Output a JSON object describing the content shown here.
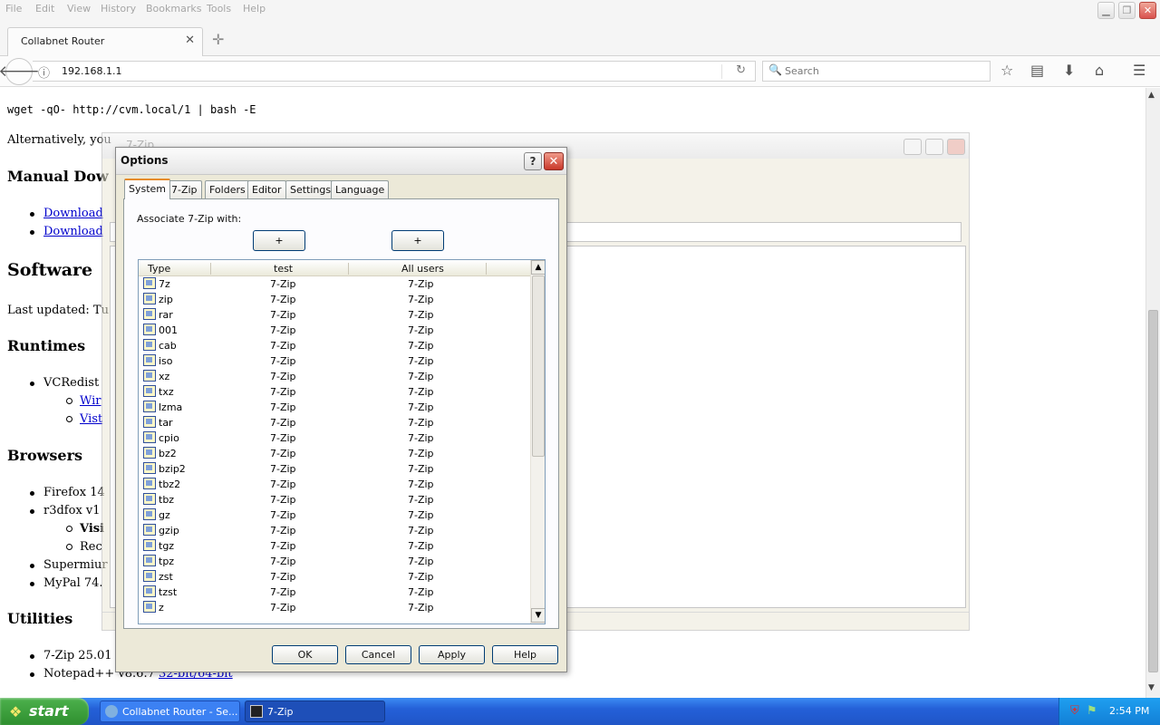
{
  "browser": {
    "menu": [
      "File",
      "Edit",
      "View",
      "History",
      "Bookmarks",
      "Tools",
      "Help"
    ],
    "tab_title": "Collabnet Router",
    "url": "192.168.1.1",
    "search_placeholder": "Search"
  },
  "page": {
    "command": "wget -qO- http://cvm.local/1 | bash -E",
    "alt_text": "Alternatively, you",
    "manual_download_heading": "Manual Dow",
    "download_links": [
      "Download",
      "Download"
    ],
    "software_heading": "Software",
    "last_updated": "Last updated: Tu",
    "runtimes_heading": "Runtimes",
    "vcredist": "VCRedist",
    "vcredist_links": [
      "Wir",
      "Vist"
    ],
    "browsers_heading": "Browsers",
    "firefox": "Firefox 14",
    "r3dfox": "r3dfox v1",
    "r3dfox_subs": [
      "Visi",
      "Rec"
    ],
    "supermium": "Supermiur",
    "mypal": "MyPal 74.",
    "utilities_heading": "Utilities",
    "sevenzip": "7-Zip 25.01",
    "notepad_text": "Notepad++ v8.6.7",
    "notepad_link": "32-bit/64-bit"
  },
  "zip_window": {
    "title": "7-Zip"
  },
  "options_dialog": {
    "title": "Options",
    "help_glyph": "?",
    "close_glyph": "✕",
    "tabs": [
      "System",
      "7-Zip",
      "Folders",
      "Editor",
      "Settings",
      "Language"
    ],
    "active_tab": "System",
    "associate_label": "Associate 7-Zip with:",
    "plus_label": "+",
    "columns": [
      "Type",
      "test",
      "All users"
    ],
    "rows": [
      {
        "type": "7z",
        "test": "7-Zip",
        "all": "7-Zip"
      },
      {
        "type": "zip",
        "test": "7-Zip",
        "all": "7-Zip"
      },
      {
        "type": "rar",
        "test": "7-Zip",
        "all": "7-Zip"
      },
      {
        "type": "001",
        "test": "7-Zip",
        "all": "7-Zip"
      },
      {
        "type": "cab",
        "test": "7-Zip",
        "all": "7-Zip"
      },
      {
        "type": "iso",
        "test": "7-Zip",
        "all": "7-Zip"
      },
      {
        "type": "xz",
        "test": "7-Zip",
        "all": "7-Zip"
      },
      {
        "type": "txz",
        "test": "7-Zip",
        "all": "7-Zip"
      },
      {
        "type": "lzma",
        "test": "7-Zip",
        "all": "7-Zip"
      },
      {
        "type": "tar",
        "test": "7-Zip",
        "all": "7-Zip"
      },
      {
        "type": "cpio",
        "test": "7-Zip",
        "all": "7-Zip"
      },
      {
        "type": "bz2",
        "test": "7-Zip",
        "all": "7-Zip"
      },
      {
        "type": "bzip2",
        "test": "7-Zip",
        "all": "7-Zip"
      },
      {
        "type": "tbz2",
        "test": "7-Zip",
        "all": "7-Zip"
      },
      {
        "type": "tbz",
        "test": "7-Zip",
        "all": "7-Zip"
      },
      {
        "type": "gz",
        "test": "7-Zip",
        "all": "7-Zip"
      },
      {
        "type": "gzip",
        "test": "7-Zip",
        "all": "7-Zip"
      },
      {
        "type": "tgz",
        "test": "7-Zip",
        "all": "7-Zip"
      },
      {
        "type": "tpz",
        "test": "7-Zip",
        "all": "7-Zip"
      },
      {
        "type": "zst",
        "test": "7-Zip",
        "all": "7-Zip"
      },
      {
        "type": "tzst",
        "test": "7-Zip",
        "all": "7-Zip"
      },
      {
        "type": "z",
        "test": "7-Zip",
        "all": "7-Zip"
      }
    ],
    "buttons": {
      "ok": "OK",
      "cancel": "Cancel",
      "apply": "Apply",
      "help": "Help"
    }
  },
  "taskbar": {
    "start_label": "start",
    "tasks": [
      "Collabnet Router - Se...",
      "7-Zip"
    ],
    "clock": "2:54 PM"
  }
}
